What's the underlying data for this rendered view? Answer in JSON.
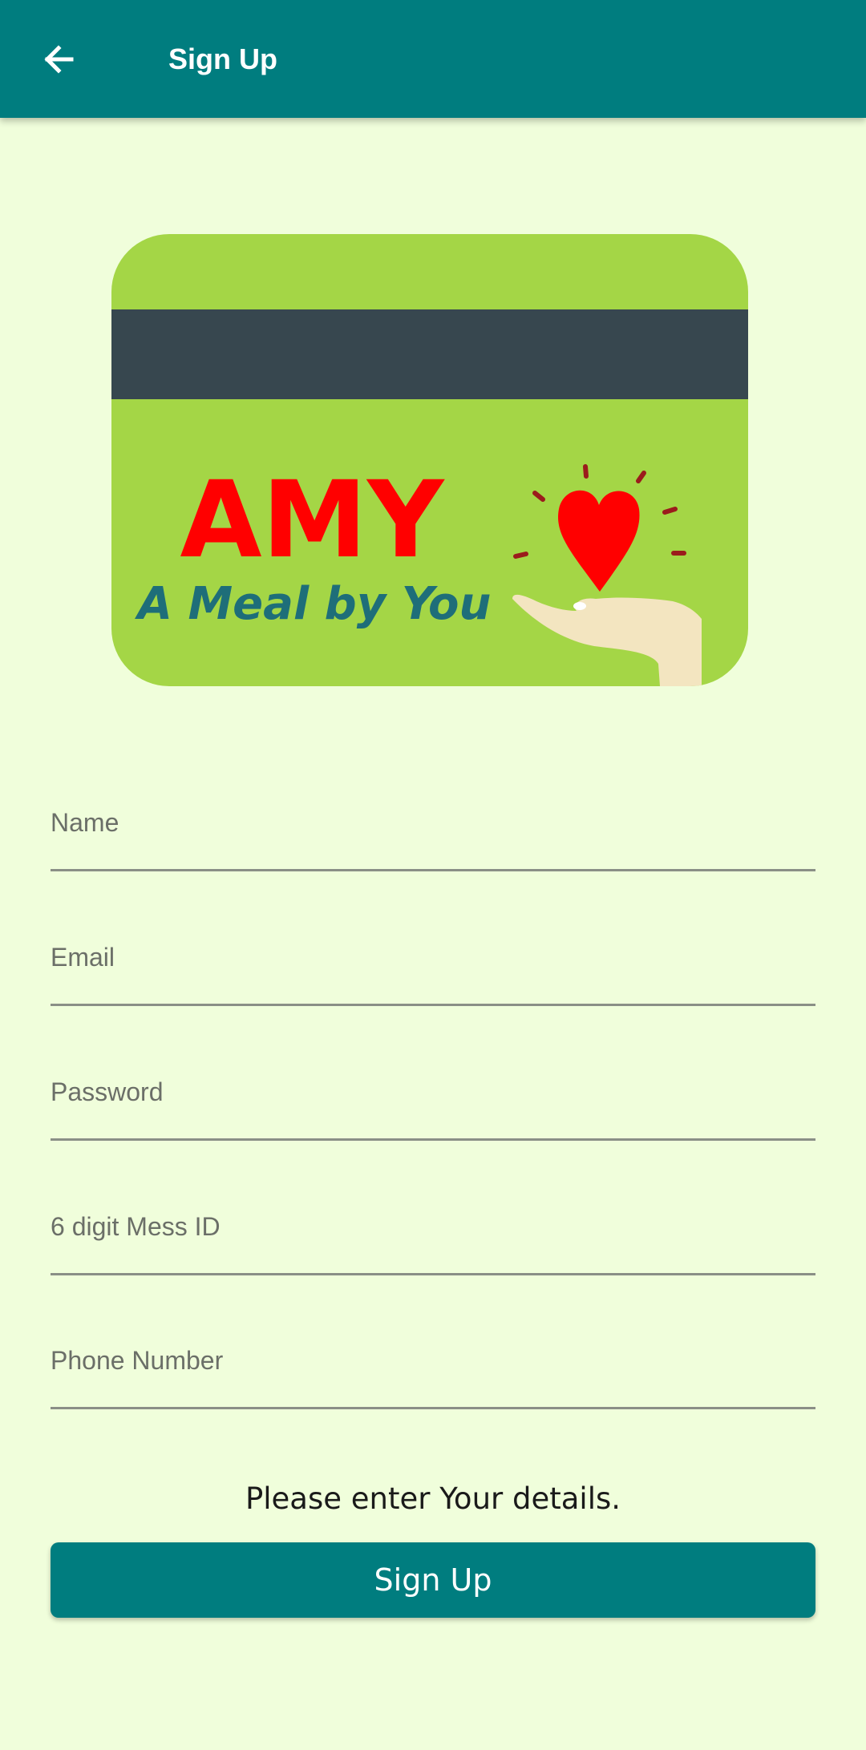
{
  "app_bar": {
    "title": "Sign Up",
    "back_icon": "arrow-left-icon",
    "background_color": "#007d7f"
  },
  "logo": {
    "brand_name": "AMY",
    "tagline": "A Meal by You",
    "icons": [
      "heart-icon",
      "hand-icon"
    ],
    "colors": {
      "card": "#a4d646",
      "stripe": "#37474f",
      "brand": "#ff0000",
      "tagline": "#1e6e79",
      "heart": "#ff0000",
      "hand": "#f3e5c0"
    }
  },
  "form": {
    "fields": [
      {
        "id": "name",
        "placeholder": "Name",
        "value": ""
      },
      {
        "id": "email",
        "placeholder": "Email",
        "value": ""
      },
      {
        "id": "password",
        "placeholder": "Password",
        "value": ""
      },
      {
        "id": "mess-id",
        "placeholder": "6 digit Mess ID",
        "value": ""
      },
      {
        "id": "phone",
        "placeholder": "Phone Number",
        "value": ""
      }
    ],
    "helper_text": "Please enter Your details.",
    "submit_label": "Sign Up"
  },
  "colors": {
    "page_background": "#f0fedb",
    "accent": "#007d7f"
  }
}
